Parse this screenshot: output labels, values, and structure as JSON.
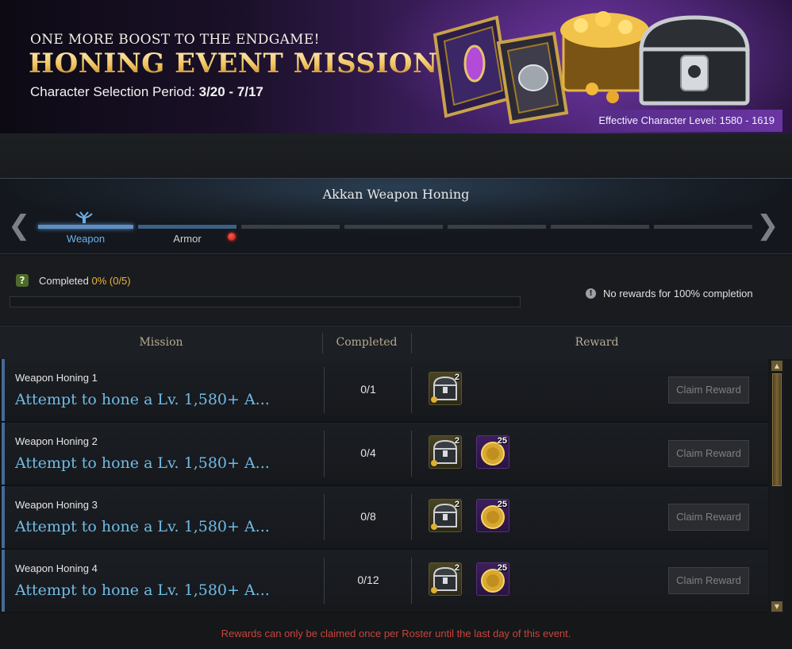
{
  "banner": {
    "tagline": "ONE MORE BOOST TO THE ENDGAME!",
    "title": "HONING EVENT MISSION",
    "period_label": "Character Selection Period: ",
    "period_value": "3/20 - 7/17",
    "level_badge": "Effective Character Level: 1580 - 1619"
  },
  "section": {
    "title": "Akkan Weapon Honing",
    "tabs": [
      {
        "label": "Weapon",
        "active": true
      },
      {
        "label": "Armor",
        "active": false,
        "notification": true
      }
    ]
  },
  "progress": {
    "label": "Completed ",
    "value": "0% (0/5)",
    "fraction": 0,
    "no_reward_note": "No rewards for 100% completion"
  },
  "table": {
    "headers": {
      "mission": "Mission",
      "completed": "Completed",
      "reward": "Reward"
    },
    "rows": [
      {
        "name": "Weapon Honing 1",
        "desc": "Attempt to hone a Lv. 1,580+ A...",
        "count": "0/1",
        "chest_qty": "2",
        "coin_qty": null,
        "button": "Claim Reward"
      },
      {
        "name": "Weapon Honing 2",
        "desc": "Attempt to hone a Lv. 1,580+ A...",
        "count": "0/4",
        "chest_qty": "2",
        "coin_qty": "25",
        "button": "Claim Reward"
      },
      {
        "name": "Weapon Honing 3",
        "desc": "Attempt to hone a Lv. 1,580+ A...",
        "count": "0/8",
        "chest_qty": "2",
        "coin_qty": "25",
        "button": "Claim Reward"
      },
      {
        "name": "Weapon Honing 4",
        "desc": "Attempt to hone a Lv. 1,580+ A...",
        "count": "0/12",
        "chest_qty": "2",
        "coin_qty": "25",
        "button": "Claim Reward"
      }
    ]
  },
  "footer": {
    "note": "Rewards can only be claimed once per Roster until the last day of this event."
  },
  "colors": {
    "accent_blue": "#5d8fc4",
    "mission_text": "#6fbbe6",
    "progress_value": "#e8b53a",
    "warning_red": "#c9443c"
  }
}
